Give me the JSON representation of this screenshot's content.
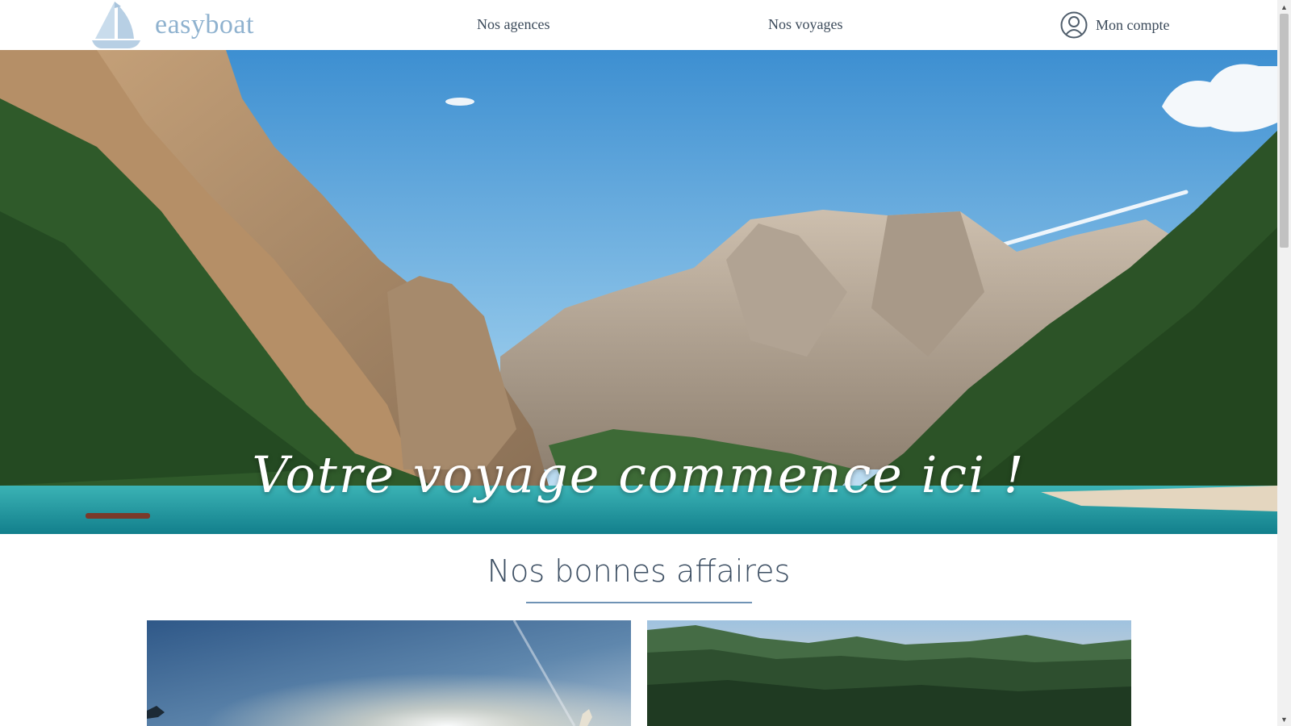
{
  "header": {
    "logo_text": "easyboat",
    "nav": {
      "agences_label": "Nos agences",
      "voyages_label": "Nos voyages"
    },
    "account_label": "Mon compte"
  },
  "hero": {
    "title": "Votre voyage commence ici !"
  },
  "deals": {
    "title": "Nos bonnes affaires"
  },
  "colors": {
    "brand": "#8fb2cf",
    "nav_text": "#3b4a5a",
    "heading": "#3d4f63",
    "underline": "#6f93b5"
  },
  "icons": {
    "logo": "sailboat-icon",
    "account": "user-circle-icon",
    "scroll_up": "chevron-up-icon",
    "scroll_down": "chevron-down-icon"
  }
}
